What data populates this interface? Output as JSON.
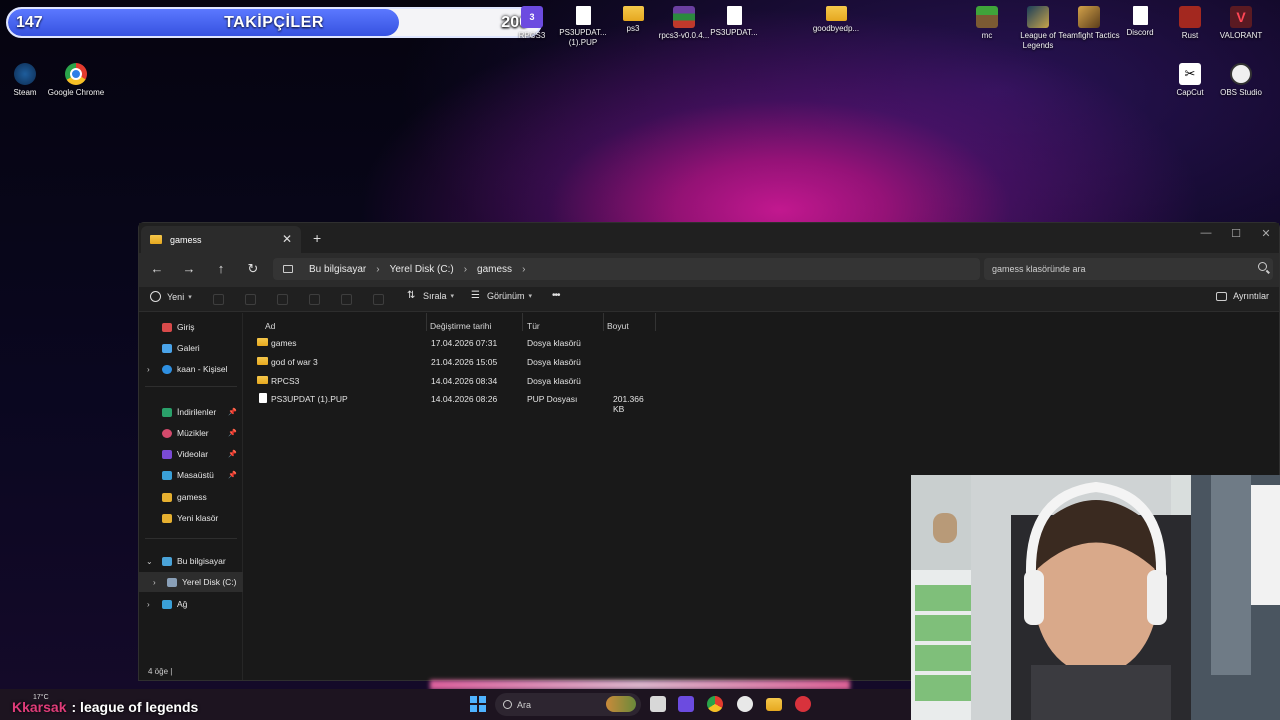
{
  "followers": {
    "current": "147",
    "title": "TAKİPÇİLER",
    "goal": "200",
    "progress": 0.735
  },
  "desktop": {
    "icons_left": [
      {
        "label": "Steam",
        "icon": "steam-icon"
      },
      {
        "label": "Google Chrome",
        "icon": "chrome-icon"
      }
    ],
    "icons_top": [
      {
        "label": "RPCS3",
        "icon": "rpcs3-icon"
      },
      {
        "label": "PS3UPDAT... (1).PUP",
        "icon": "file-icon"
      },
      {
        "label": "ps3",
        "icon": "folder-icon"
      },
      {
        "label": "rpcs3-v0.0.4...",
        "icon": "winrar-icon"
      },
      {
        "label": "PS3UPDAT...",
        "icon": "file-icon"
      },
      {
        "label": "goodbyedp...",
        "icon": "folder-icon"
      }
    ],
    "icons_right": [
      {
        "label": "mc",
        "icon": "minecraft-icon"
      },
      {
        "label": "League of Legends",
        "icon": "league-icon"
      },
      {
        "label": "Teamfight Tactics",
        "icon": "tft-icon"
      },
      {
        "label": "Discord",
        "icon": "file-icon"
      },
      {
        "label": "Rust",
        "icon": "rust-icon"
      },
      {
        "label": "VALORANT",
        "icon": "valorant-icon"
      },
      {
        "label": "CapCut",
        "icon": "capcut-icon"
      },
      {
        "label": "OBS Studio",
        "icon": "obs-icon"
      }
    ]
  },
  "explorer": {
    "tab_title": "gamess",
    "tab_close": "✕",
    "tab_add": "+",
    "window_controls": {
      "minimize": "—",
      "maximize": "☐",
      "close": "✕"
    },
    "nav": {
      "back": "←",
      "forward": "→",
      "up": "↑",
      "refresh": "↻"
    },
    "breadcrumb": [
      "Bu bilgisayar",
      "Yerel Disk (C:)",
      "gamess"
    ],
    "breadcrumb_sep": "›",
    "search_placeholder": "gamess klasöründe ara",
    "toolbar": {
      "new": "Yeni",
      "sort": "Sırala",
      "view": "Görünüm",
      "more": "•••",
      "details": "Ayrıntılar"
    },
    "sidebar": {
      "quick": [
        {
          "label": "Giriş",
          "color": "#d84a4a"
        },
        {
          "label": "Galeri",
          "color": "#4aa3e8"
        },
        {
          "label": "kaan - Kişisel",
          "color": "#2e8fe0"
        }
      ],
      "pinned": [
        {
          "label": "İndirilenler",
          "color": "#2aa06a",
          "pinned": true
        },
        {
          "label": "Müzikler",
          "color": "#d44a6c",
          "pinned": true
        },
        {
          "label": "Videolar",
          "color": "#7a4ad4",
          "pinned": true
        },
        {
          "label": "Masaüstü",
          "color": "#3aa0d8",
          "pinned": true
        },
        {
          "label": "gamess",
          "color": "#e6b030",
          "pinned": false
        },
        {
          "label": "Yeni klasör",
          "color": "#e6b030",
          "pinned": false
        }
      ],
      "this_pc": "Bu bilgisayar",
      "local_disk": "Yerel Disk (C:)",
      "network": "Ağ"
    },
    "columns": {
      "name": "Ad",
      "date": "Değiştirme tarihi",
      "type": "Tür",
      "size": "Boyut"
    },
    "files": [
      {
        "name": "games",
        "date": "17.04.2026 07:31",
        "type": "Dosya klasörü",
        "size": "",
        "kind": "folder"
      },
      {
        "name": "god of war 3",
        "date": "21.04.2026 15:05",
        "type": "Dosya klasörü",
        "size": "",
        "kind": "folder"
      },
      {
        "name": "RPCS3",
        "date": "14.04.2026 08:34",
        "type": "Dosya klasörü",
        "size": "",
        "kind": "folder"
      },
      {
        "name": "PS3UPDAT (1).PUP",
        "date": "14.04.2026 08:26",
        "type": "PUP Dosyası",
        "size": "201.366 KB",
        "kind": "file"
      }
    ],
    "status": "4 öğe  |"
  },
  "taskbar": {
    "search": "Ara"
  },
  "chat": {
    "user": "Kkarsak",
    "message": ": league of legends"
  },
  "weather": "17°C"
}
